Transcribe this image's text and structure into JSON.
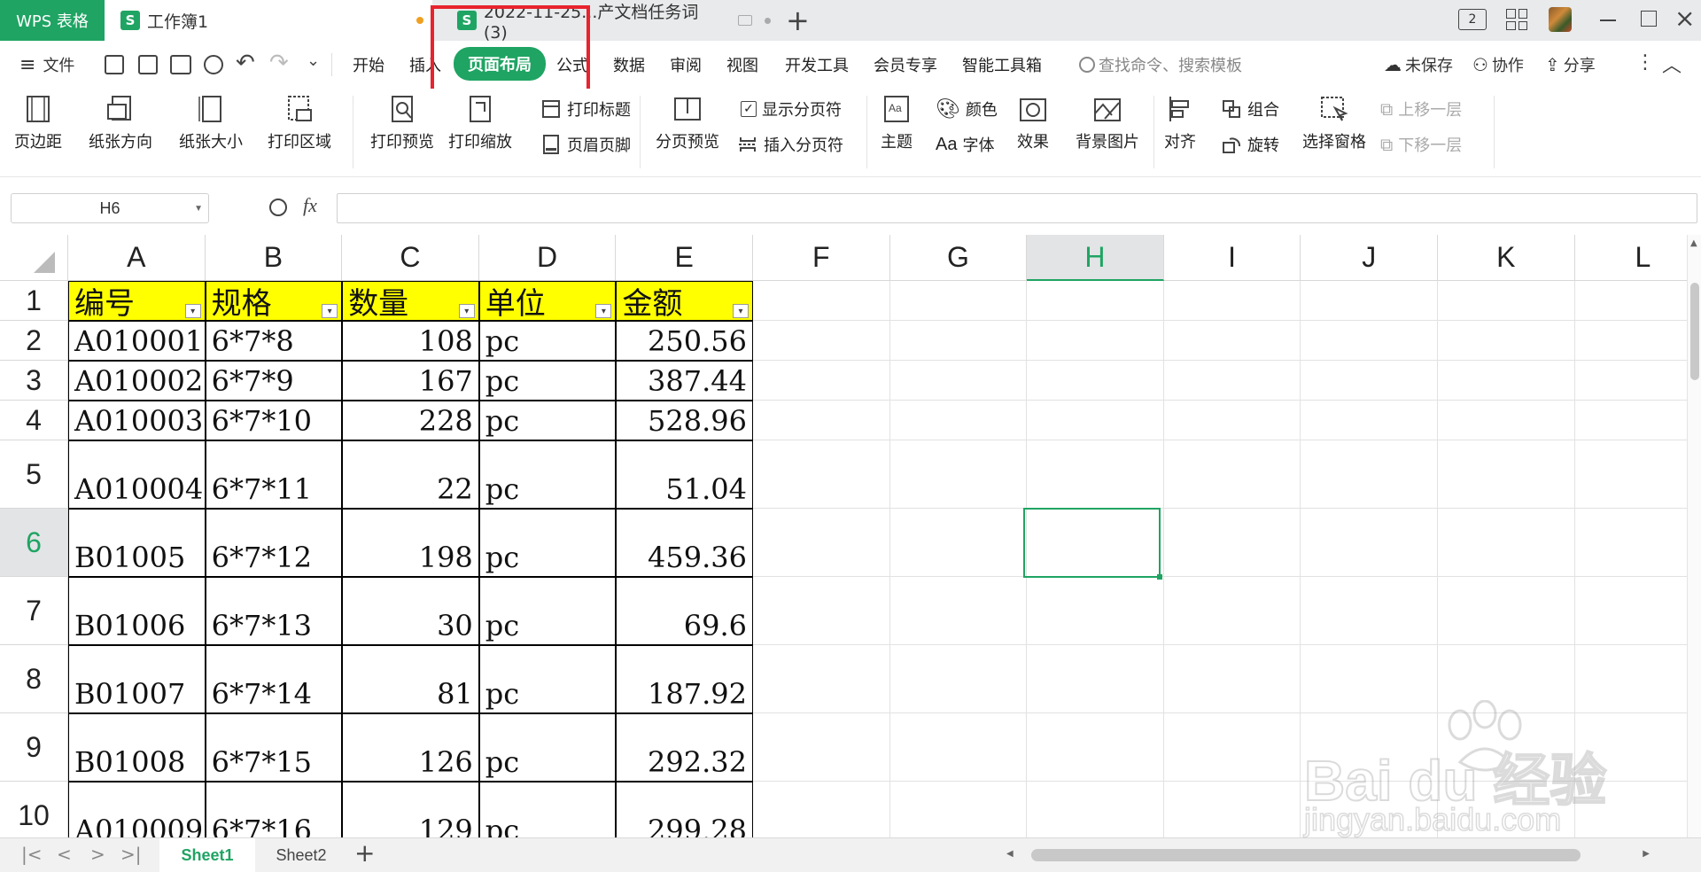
{
  "titlebar": {
    "app_label": "WPS 表格",
    "tab1_label": "工作簿1",
    "tab2_label": "2022-11-25...产文档任务词 (3)",
    "user_badge": "2"
  },
  "menubar": {
    "file_label": "文件",
    "items": [
      "开始",
      "插入",
      "页面布局",
      "公式",
      "数据",
      "审阅",
      "视图",
      "开发工具",
      "会员专享",
      "智能工具箱"
    ],
    "search_placeholder": "查找命令、搜索模板",
    "unsaved_label": "未保存",
    "collab_label": "协作",
    "share_label": "分享"
  },
  "ribbon": {
    "margins": "页边距",
    "orientation": "纸张方向",
    "size": "纸张大小",
    "print_area": "打印区域",
    "print_preview": "打印预览",
    "print_scale": "打印缩放",
    "print_titles": "打印标题",
    "header_footer": "页眉页脚",
    "page_break_preview": "分页预览",
    "show_page_breaks": "显示分页符",
    "insert_page_break": "插入分页符",
    "theme": "主题",
    "colors": "颜色",
    "fonts": "字体",
    "effects": "效果",
    "background_image": "背景图片",
    "align": "对齐",
    "group": "组合",
    "rotate": "旋转",
    "selection_pane": "选择窗格",
    "bring_forward": "上移一层",
    "send_backward": "下移一层"
  },
  "formula_bar": {
    "name_box": "H6",
    "fx": "fx",
    "value": ""
  },
  "sheet": {
    "columns": [
      "A",
      "B",
      "C",
      "D",
      "E",
      "F",
      "G",
      "H",
      "I",
      "J",
      "K",
      "L"
    ],
    "active_column": "H",
    "active_row": "6",
    "header_row": [
      "编号",
      "规格",
      "数量",
      "单位",
      "金额"
    ],
    "rows": [
      {
        "row": "2",
        "cells": [
          "A010001",
          "6*7*8",
          "108",
          "pc",
          "250.56"
        ]
      },
      {
        "row": "3",
        "cells": [
          "A010002",
          "6*7*9",
          "167",
          "pc",
          "387.44"
        ]
      },
      {
        "row": "4",
        "cells": [
          "A010003",
          "6*7*10",
          "228",
          "pc",
          "528.96"
        ]
      },
      {
        "row": "5",
        "cells": [
          "A010004",
          "6*7*11",
          "22",
          "pc",
          "51.04"
        ]
      },
      {
        "row": "6",
        "cells": [
          "B01005",
          "6*7*12",
          "198",
          "pc",
          "459.36"
        ]
      },
      {
        "row": "7",
        "cells": [
          "B01006",
          "6*7*13",
          "30",
          "pc",
          "69.6"
        ]
      },
      {
        "row": "8",
        "cells": [
          "B01007",
          "6*7*14",
          "81",
          "pc",
          "187.92"
        ]
      },
      {
        "row": "9",
        "cells": [
          "B01008",
          "6*7*15",
          "126",
          "pc",
          "292.32"
        ]
      },
      {
        "row": "10",
        "cells": [
          "A010009",
          "6*7*16",
          "129",
          "pc",
          "299.28"
        ]
      }
    ]
  },
  "sheets": {
    "tabs": [
      "Sheet1",
      "Sheet2"
    ],
    "active": "Sheet1"
  },
  "watermark": {
    "brand": "Bai du 经验",
    "url": "jingyan.baidu.com"
  },
  "colors": {
    "accent_green": "#1fa463",
    "header_yellow": "#ffff00",
    "highlight_red": "#e8232d"
  }
}
